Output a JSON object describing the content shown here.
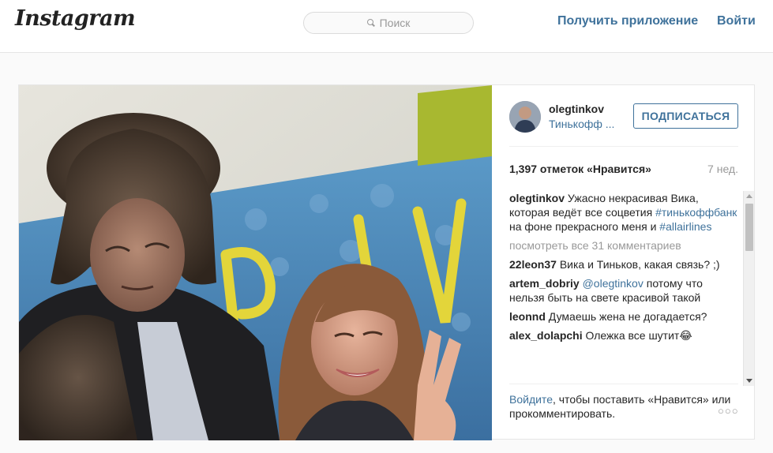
{
  "header": {
    "logo": "Instagram",
    "search_placeholder": "Поиск",
    "get_app": "Получить приложение",
    "login": "Войти"
  },
  "post": {
    "photo": "selfie-photo",
    "author": {
      "username": "olegtinkov",
      "full_name": "Тинькофф ...",
      "follow_label": "ПОДПИСАТЬСЯ"
    },
    "likes": "1,397 отметок «Нравится»",
    "age": "7 нед.",
    "caption": {
      "user": "olegtinkov",
      "text_1": "Ужасно некрасивая Вика, которая ведёт все соцветия",
      "tag_1": "#тинькоффбанк",
      "text_2": "на фоне прекрасного меня и",
      "tag_2": "#allairlines"
    },
    "view_all": "посмотреть все 31 комментариев",
    "comments": [
      {
        "user": "22leon37",
        "text": "Вика и Тиньков, какая связь? ;)"
      },
      {
        "user": "artem_dobriy",
        "mention": "@olegtinkov",
        "text": "потому что нельзя быть на свете красивой такой"
      },
      {
        "user": "leonnd",
        "text": "Думаешь жена не догадается?"
      },
      {
        "user": "alex_dolapchi",
        "text": "Олежка все шутит😂"
      }
    ],
    "footer": {
      "login_link": "Войдите",
      "text": ", чтобы поставить «Нравится» или прокомментировать."
    },
    "more_options": "○○○"
  },
  "colors": {
    "accent": "#3f729b",
    "muted": "#999999",
    "border": "#e6e6e6"
  }
}
